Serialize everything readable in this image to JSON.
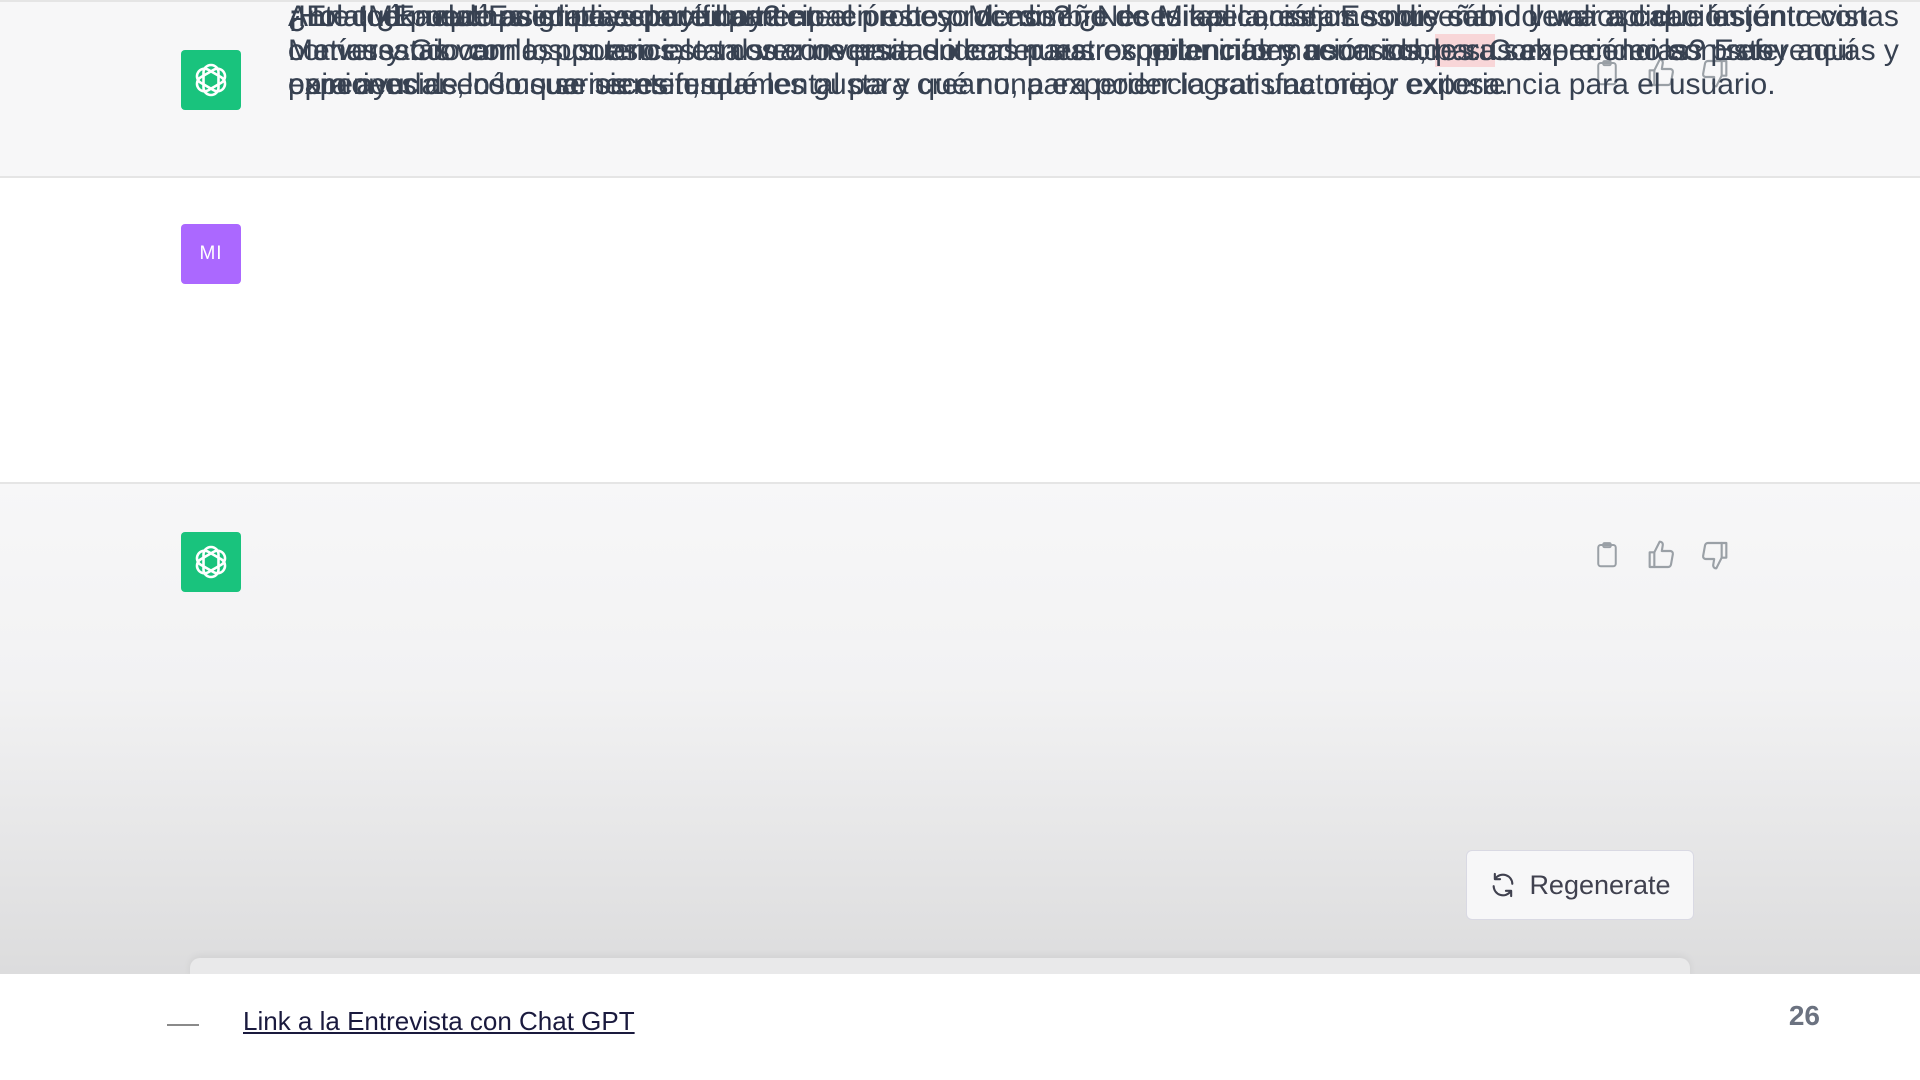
{
  "conversation": {
    "messages": [
      {
        "role": "assistant",
        "text": "¡Hola! ¿En qué puedo ayudarte hoy?"
      },
      {
        "role": "user",
        "avatar_initials": "MI",
        "text_before": "Ante todo muchas gracias por tu participación hoy. Mi nombre es Mikaela, estamos diseñando una aplicación junto con Matías y Giovanna, por eso estamos conversando con nuestros potenciales usuarios, ",
        "highlighted_word": "para",
        "text_after": " saber cómo son sus experiencias, cómo se sienten, qué les gusta y qué no, para poder lograr una mejor experiencia para el usuario."
      },
      {
        "role": "assistant",
        "paragraphs": [
          "¡Hola Mikaela! Es un placer ayudarte en el proceso de diseño de tu aplicación. Es muy sabio y valioso que estén conversando con los potenciales usuarios para entender sus experiencias y necesidades. Comprender las preferencias y opiniones de los usuarios es fundamental para crear una experiencia satisfactoria y exitosa.",
          "¿En qué puedo asistirte específicamente en este proceso? ¿Necesitas consejos sobre cómo llevar a cabo las entrevistas o encuestas con los usuarios, o tal vez necesitas ideas para recopilar información sobre sus experiencias? Estoy aquí para ayudar en lo que necesites."
        ]
      }
    ],
    "regenerate_label": "Regenerate"
  },
  "footer": {
    "link_text": "Link a la Entrevista con Chat GPT",
    "page_number": "26"
  },
  "colors": {
    "assistant_avatar": "#19c37d",
    "user_avatar": "#ab68ff",
    "highlight": "#f8d6d8"
  },
  "icons": [
    "openai-logo-icon",
    "copy-icon",
    "thumbs-up-icon",
    "thumbs-down-icon",
    "refresh-icon"
  ]
}
